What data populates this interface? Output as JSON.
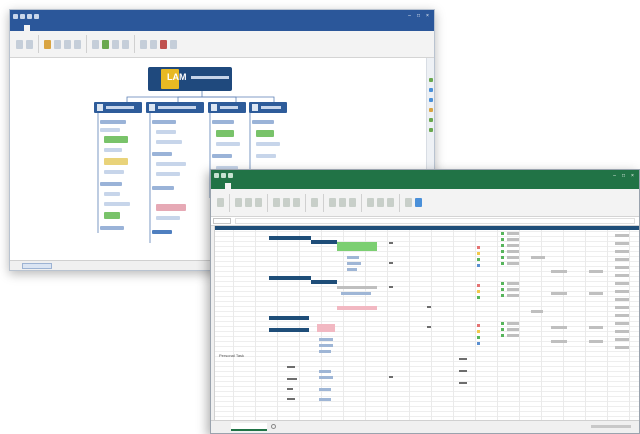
{
  "mindmap_window": {
    "central_node": {
      "logo_text": "LAM"
    }
  },
  "spreadsheet_window": {
    "sheet_label": "Personal Task"
  }
}
